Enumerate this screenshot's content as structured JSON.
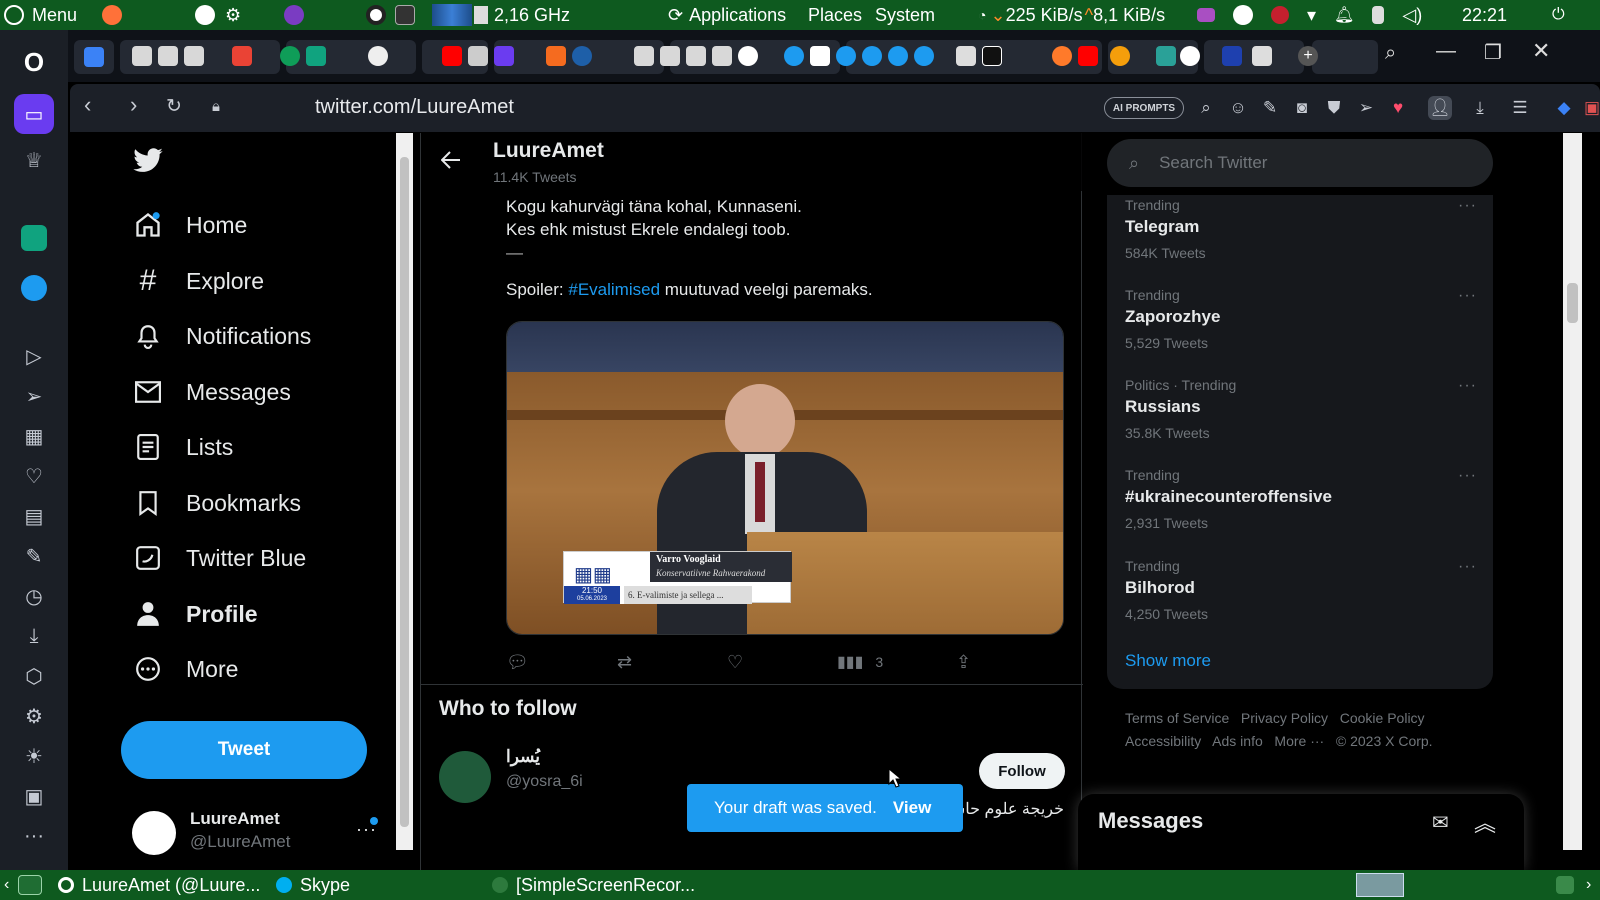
{
  "system_bar": {
    "menu_label": "Menu",
    "cpu_freq": "2,16 GHz",
    "applications": "Applications",
    "places": "Places",
    "system": "System",
    "net_down": "225 KiB/s",
    "net_up": "8,1 KiB/s",
    "clock": "22:21"
  },
  "browser": {
    "url": "twitter.com/LuureAmet",
    "ai_prompts_label": "AI PROMPTS"
  },
  "left_nav": {
    "items": [
      {
        "label": "Home",
        "icon": "home-icon"
      },
      {
        "label": "Explore",
        "icon": "hash-icon"
      },
      {
        "label": "Notifications",
        "icon": "bell-icon"
      },
      {
        "label": "Messages",
        "icon": "envelope-icon"
      },
      {
        "label": "Lists",
        "icon": "list-icon"
      },
      {
        "label": "Bookmarks",
        "icon": "bookmark-icon"
      },
      {
        "label": "Twitter Blue",
        "icon": "twitter-blue-icon"
      },
      {
        "label": "Profile",
        "icon": "person-icon"
      },
      {
        "label": "More",
        "icon": "more-circle-icon"
      }
    ],
    "tweet_button": "Tweet",
    "account": {
      "name": "LuureAmet",
      "handle": "@LuureAmet"
    }
  },
  "profile_header": {
    "name": "LuureAmet",
    "tweets_count": "11.4K Tweets"
  },
  "tweet": {
    "line1": "Kogu kahurvägi täna kohal, Kunnaseni.",
    "line2": "Kes ehk mistust Ekrele endalegi toob.",
    "line3": "—",
    "spoiler_prefix": "Spoiler: ",
    "hashtag": "#Evalimised",
    "spoiler_suffix": " muutuvad veelgi paremaks.",
    "media_caption": {
      "name": "Varro Vooglaid",
      "party": "Konservatiivne Rahvaerakond",
      "time": "21:50",
      "date": "05.06.2023",
      "agenda": "6. E-valimiste ja sellega ..."
    },
    "views": "3"
  },
  "who_to_follow": {
    "title": "Who to follow",
    "user_name": "يُسرا",
    "user_handle": "@yosra_6i",
    "user_bio": "خريجة علوم حاسب",
    "follow_label": "Follow"
  },
  "search": {
    "placeholder": "Search Twitter"
  },
  "trends": [
    {
      "context": "Trending",
      "name": "Telegram",
      "count": "584K Tweets"
    },
    {
      "context": "Trending",
      "name": "Zaporozhye",
      "count": "5,529 Tweets"
    },
    {
      "context": "Politics · Trending",
      "name": "Russians",
      "count": "35.8K Tweets"
    },
    {
      "context": "Trending",
      "name": "#ukrainecounteroffensive",
      "count": "2,931 Tweets"
    },
    {
      "context": "Trending",
      "name": "Bilhorod",
      "count": "4,250 Tweets"
    }
  ],
  "show_more": "Show more",
  "footer": {
    "terms": "Terms of Service",
    "privacy": "Privacy Policy",
    "cookie": "Cookie Policy",
    "accessibility": "Accessibility",
    "ads": "Ads info",
    "more": "More ···",
    "copyright": "© 2023 X Corp."
  },
  "messages_dock": {
    "title": "Messages"
  },
  "toast": {
    "text": "Your draft was saved.",
    "action": "View"
  },
  "taskbar": {
    "win1": "LuureAmet (@Luure...",
    "win2": "Skype",
    "win3": "[SimpleScreenRecor..."
  },
  "colors": {
    "accent": "#1d9bf0",
    "panel": "#0e5a1f",
    "bg": "#000000"
  }
}
